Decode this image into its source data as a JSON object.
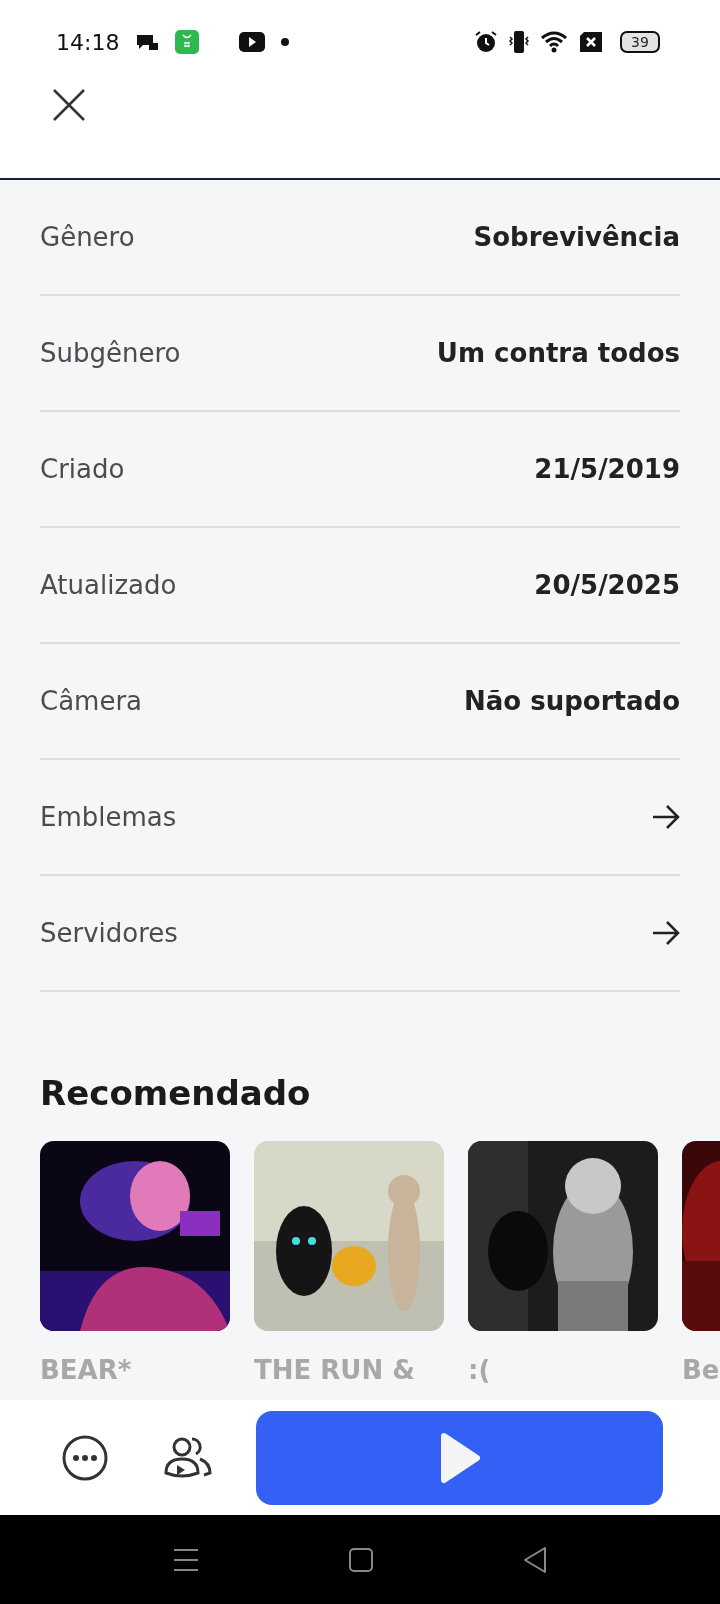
{
  "status_bar": {
    "time": "14:18",
    "battery": "39"
  },
  "details": [
    {
      "kind": "value",
      "label": "Gênero",
      "value": "Sobrevivência"
    },
    {
      "kind": "value",
      "label": "Subgênero",
      "value": "Um contra todos"
    },
    {
      "kind": "value",
      "label": "Criado",
      "value": "21/5/2019"
    },
    {
      "kind": "value",
      "label": "Atualizado",
      "value": "20/5/2025"
    },
    {
      "kind": "value",
      "label": "Câmera",
      "value": "Não suportado"
    },
    {
      "kind": "link",
      "label": "Emblemas"
    },
    {
      "kind": "link",
      "label": "Servidores"
    }
  ],
  "recommended": {
    "title": "Recomendado",
    "items": [
      {
        "title": "BEAR*",
        "kind": "picture"
      },
      {
        "title": "THE RUN &",
        "kind": "picture"
      },
      {
        "title": ":(",
        "kind": "picture"
      },
      {
        "title": "Be",
        "kind": "picture"
      }
    ]
  }
}
